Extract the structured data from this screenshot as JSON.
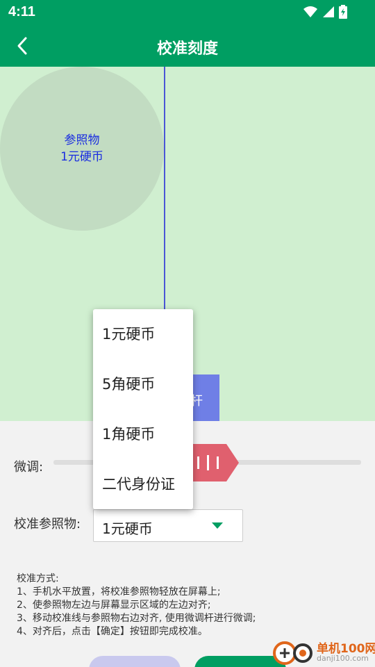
{
  "status_bar": {
    "time": "4:11"
  },
  "app_bar": {
    "title": "校准刻度"
  },
  "reference_coin": {
    "line1": "参照物",
    "line2": "1元硬币"
  },
  "slider_handle": {
    "label_visible": "杆"
  },
  "fine_tune": {
    "label": "微调:"
  },
  "reference": {
    "label": "校准参照物:",
    "selected": "1元硬币"
  },
  "dropdown": {
    "options": [
      "1元硬币",
      "5角硬币",
      "1角硬币",
      "二代身份证"
    ]
  },
  "instructions": {
    "title": "校准方式:",
    "steps": [
      "1、手机水平放置，将校准参照物轻放在屏幕上;",
      "2、使参照物左边与屏幕显示区域的左边对齐;",
      "3、移动校准线与参照物右边对齐, 使用微调杆进行微调;",
      "4、对齐后，点击【确定】按钮即完成校准。"
    ]
  },
  "watermark": {
    "title": "单机100网",
    "url": "danji100.com"
  },
  "colors": {
    "primary": "#009e62",
    "canvas_bg": "#d0efd0",
    "coin": "#c2dcc2",
    "calib_line": "#4a55d6",
    "handle": "#6f7fe6",
    "fine_thumb": "#e0606e"
  },
  "icons": {
    "back": "chevron-left-icon",
    "wifi": "wifi-icon",
    "signal": "signal-icon",
    "battery": "battery-icon",
    "dropdown": "caret-down-icon"
  }
}
